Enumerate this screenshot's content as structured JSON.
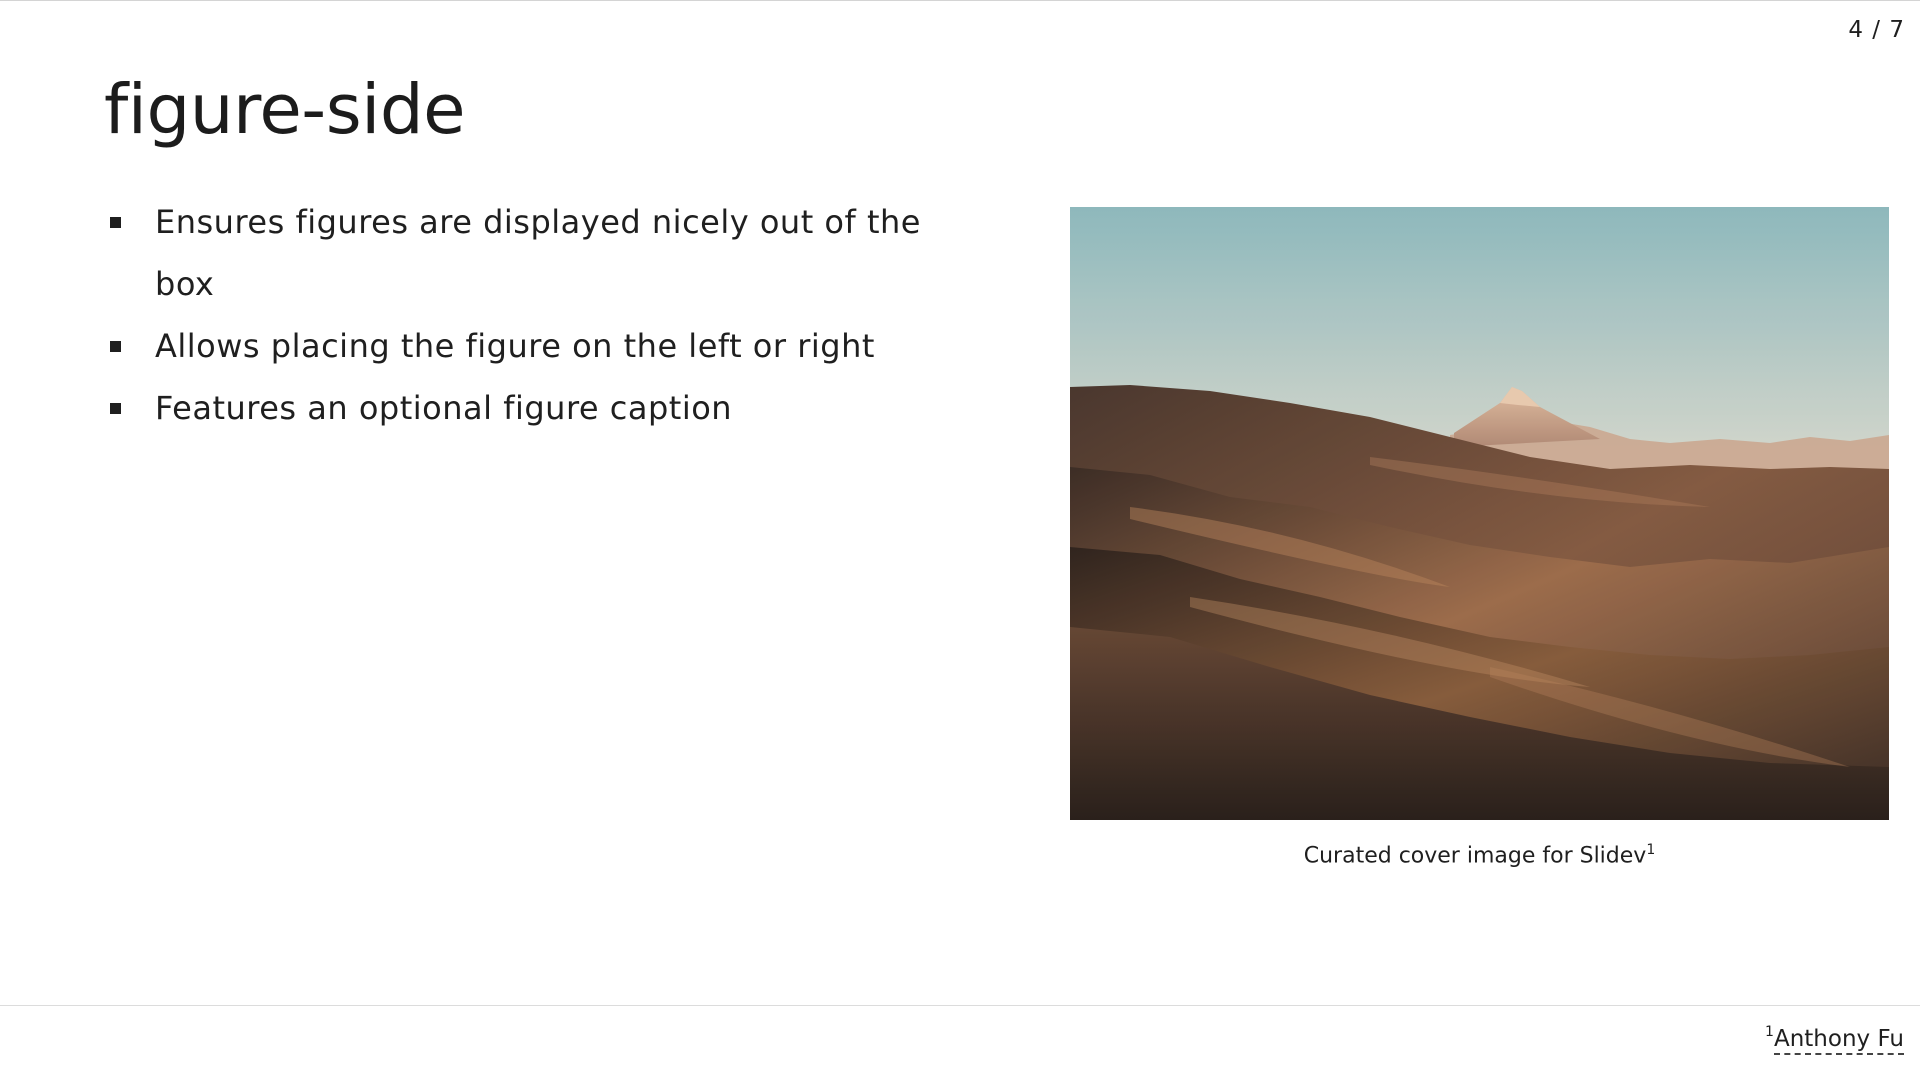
{
  "slide": {
    "page_counter": "4 / 7",
    "title": "figure-side",
    "bullets": [
      "Ensures figures are displayed nicely out of the box",
      "Allows placing the figure on the left or right",
      "Features an optional figure caption"
    ],
    "figure": {
      "caption_text": "Curated cover image for Slidev",
      "caption_ref": "1",
      "image_subject": "mountain-hills-landscape"
    },
    "footnote": {
      "number": "1",
      "text": "Anthony Fu"
    }
  }
}
